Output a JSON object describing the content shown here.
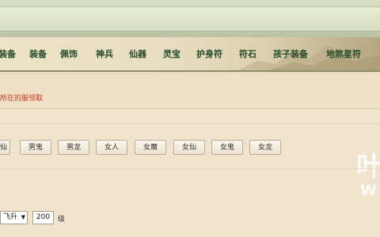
{
  "nav": {
    "items": [
      "装备",
      "装备",
      "佩饰",
      "神兵",
      "仙器",
      "灵宝",
      "护身符",
      "符石",
      "孩子装备",
      "地煞星符"
    ]
  },
  "notice": "所在的服领取",
  "classes": [
    "仙",
    "男鬼",
    "男龙",
    "女人",
    "女魔",
    "女仙",
    "女鬼",
    "女龙"
  ],
  "level": {
    "select_value": "飞升",
    "input_value": "200",
    "unit": "级"
  },
  "watermark": {
    "big": "叶",
    "small": "W"
  }
}
